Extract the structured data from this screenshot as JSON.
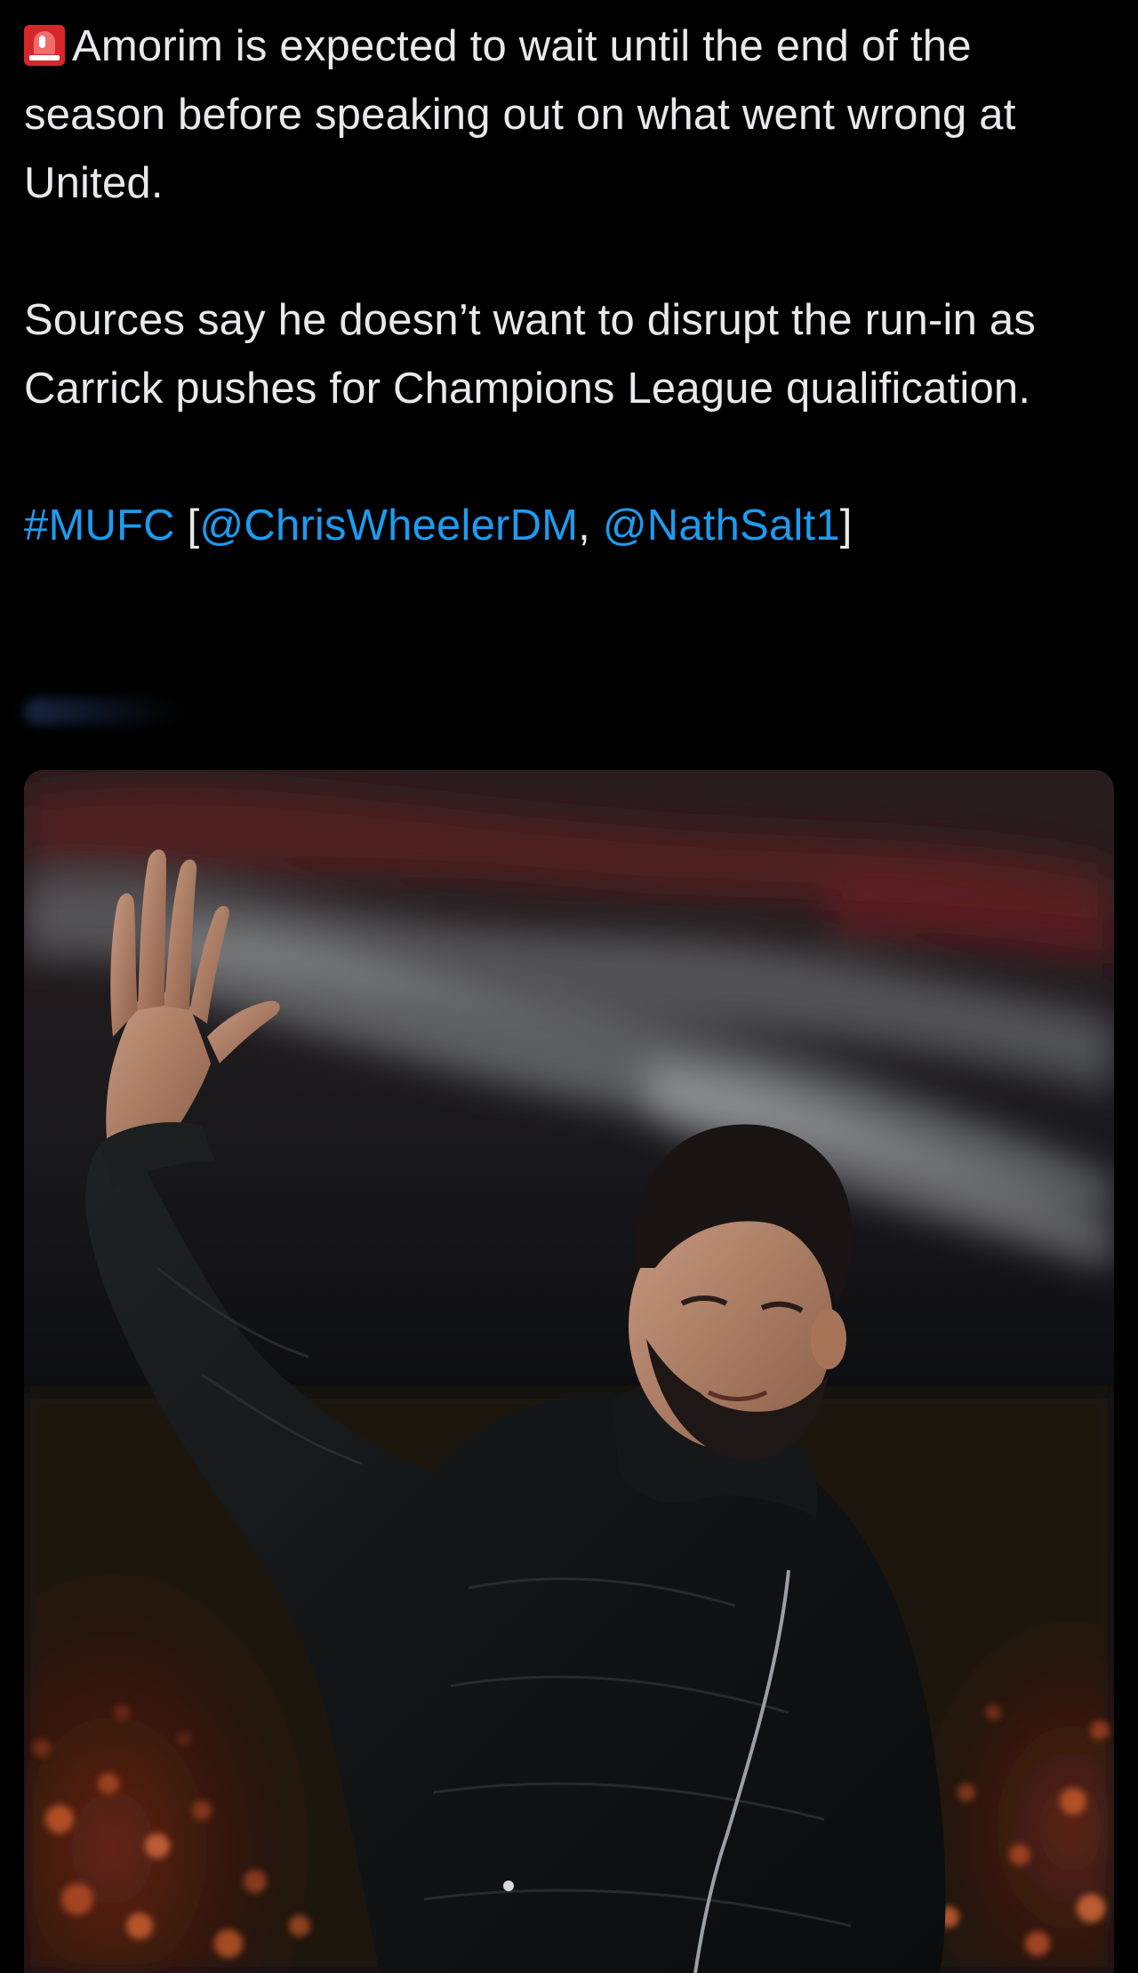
{
  "tweet": {
    "alert_icon": "rotating-light-icon",
    "paragraph_1": "Amorim is expected to wait until the end of the season before speaking out on what went wrong at United.",
    "paragraph_2": "Sources say he doesn’t want to disrupt the run-in as Carrick pushes for Champions League qualification.",
    "hashtag": "#MUFC",
    "bracket_open": " [",
    "mention_1": "@ChrisWheelerDM",
    "separator": ", ",
    "mention_2": "@NathSalt1",
    "bracket_close": "]"
  },
  "media": {
    "image_icon": "photo-image"
  },
  "colors": {
    "background": "#000000",
    "text": "#e7e9ea",
    "link": "#1d9bf0",
    "alert": "#d7262c"
  }
}
